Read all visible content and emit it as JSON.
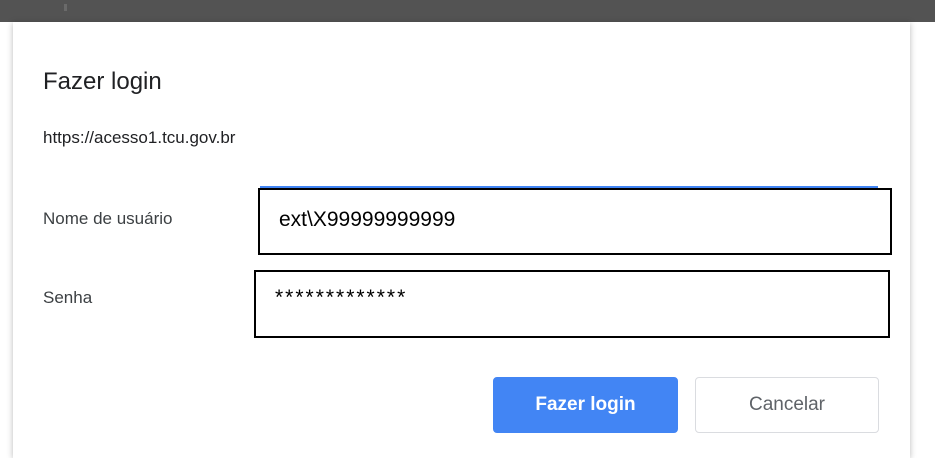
{
  "dialog": {
    "title": "Fazer login",
    "url": "https://acesso1.tcu.gov.br"
  },
  "form": {
    "username_label": "Nome de usuário",
    "username_value": "ext\\X99999999999",
    "password_label": "Senha",
    "password_value": "*************"
  },
  "buttons": {
    "login_label": "Fazer login",
    "cancel_label": "Cancelar"
  },
  "colors": {
    "primary": "#4285f4",
    "backdrop": "#535353"
  }
}
